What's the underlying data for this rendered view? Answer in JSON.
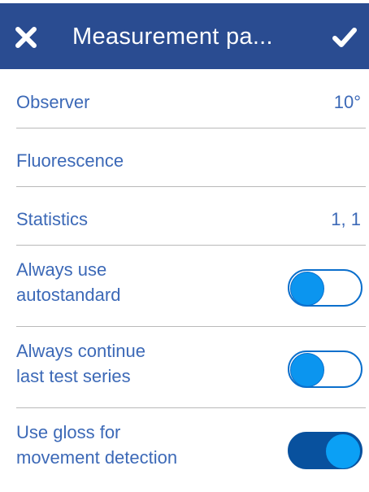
{
  "header": {
    "title": "Measurement pa...",
    "close_icon": "close-x-icon",
    "confirm_icon": "checkmark-icon",
    "background": "#2a4c91"
  },
  "rows": [
    {
      "label": "Observer",
      "value": "10°"
    },
    {
      "label": "Fluorescence",
      "value": ""
    },
    {
      "label": "Statistics",
      "value": "1, 1"
    }
  ],
  "toggles": [
    {
      "label_line1": "Always use",
      "label_line2": "autostandard",
      "on": false
    },
    {
      "label_line1": "Always continue",
      "label_line2": "last test series",
      "on": false
    },
    {
      "label_line1": "Use gloss for",
      "label_line2": "movement detection",
      "on": true
    }
  ],
  "colors": {
    "label_text": "#3c69b7",
    "toggle_on_track": "#08519e",
    "toggle_knob": "#0b95ef"
  }
}
